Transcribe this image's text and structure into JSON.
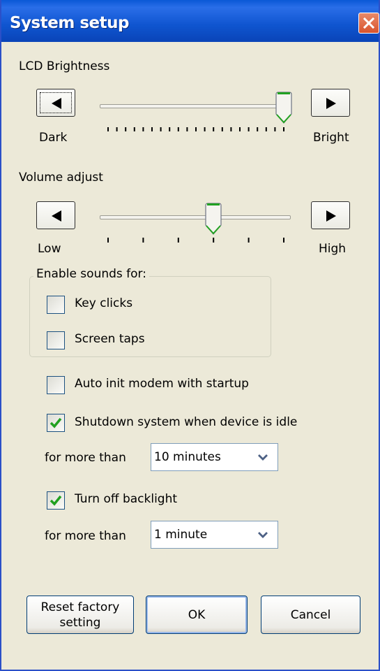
{
  "window": {
    "title": "System setup",
    "colors": {
      "titlebar": "#0a58d6",
      "background": "#ece9d8",
      "close": "#d9532c",
      "check": "#21a121"
    }
  },
  "brightness": {
    "label": "LCD Brightness",
    "min_label": "Dark",
    "max_label": "Bright",
    "value_fraction": 1.0
  },
  "volume": {
    "label": "Volume adjust",
    "min_label": "Low",
    "max_label": "High",
    "value_fraction": 0.6
  },
  "sounds_group": {
    "legend": "Enable sounds for:",
    "key_clicks": {
      "label": "Key clicks",
      "checked": false
    },
    "screen_taps": {
      "label": "Screen taps",
      "checked": false
    }
  },
  "options": {
    "auto_init_modem": {
      "label": "Auto init modem with startup",
      "checked": false
    },
    "shutdown_idle": {
      "label": "Shutdown system when device is idle",
      "checked": true
    },
    "shutdown_prefix": "for more than",
    "shutdown_value": "10 minutes",
    "backlight_off": {
      "label": "Turn off backlight",
      "checked": true
    },
    "backlight_prefix": "for more than",
    "backlight_value": "1 minute"
  },
  "buttons": {
    "reset_line1": "Reset factory",
    "reset_line2": "setting",
    "ok": "OK",
    "cancel": "Cancel"
  }
}
